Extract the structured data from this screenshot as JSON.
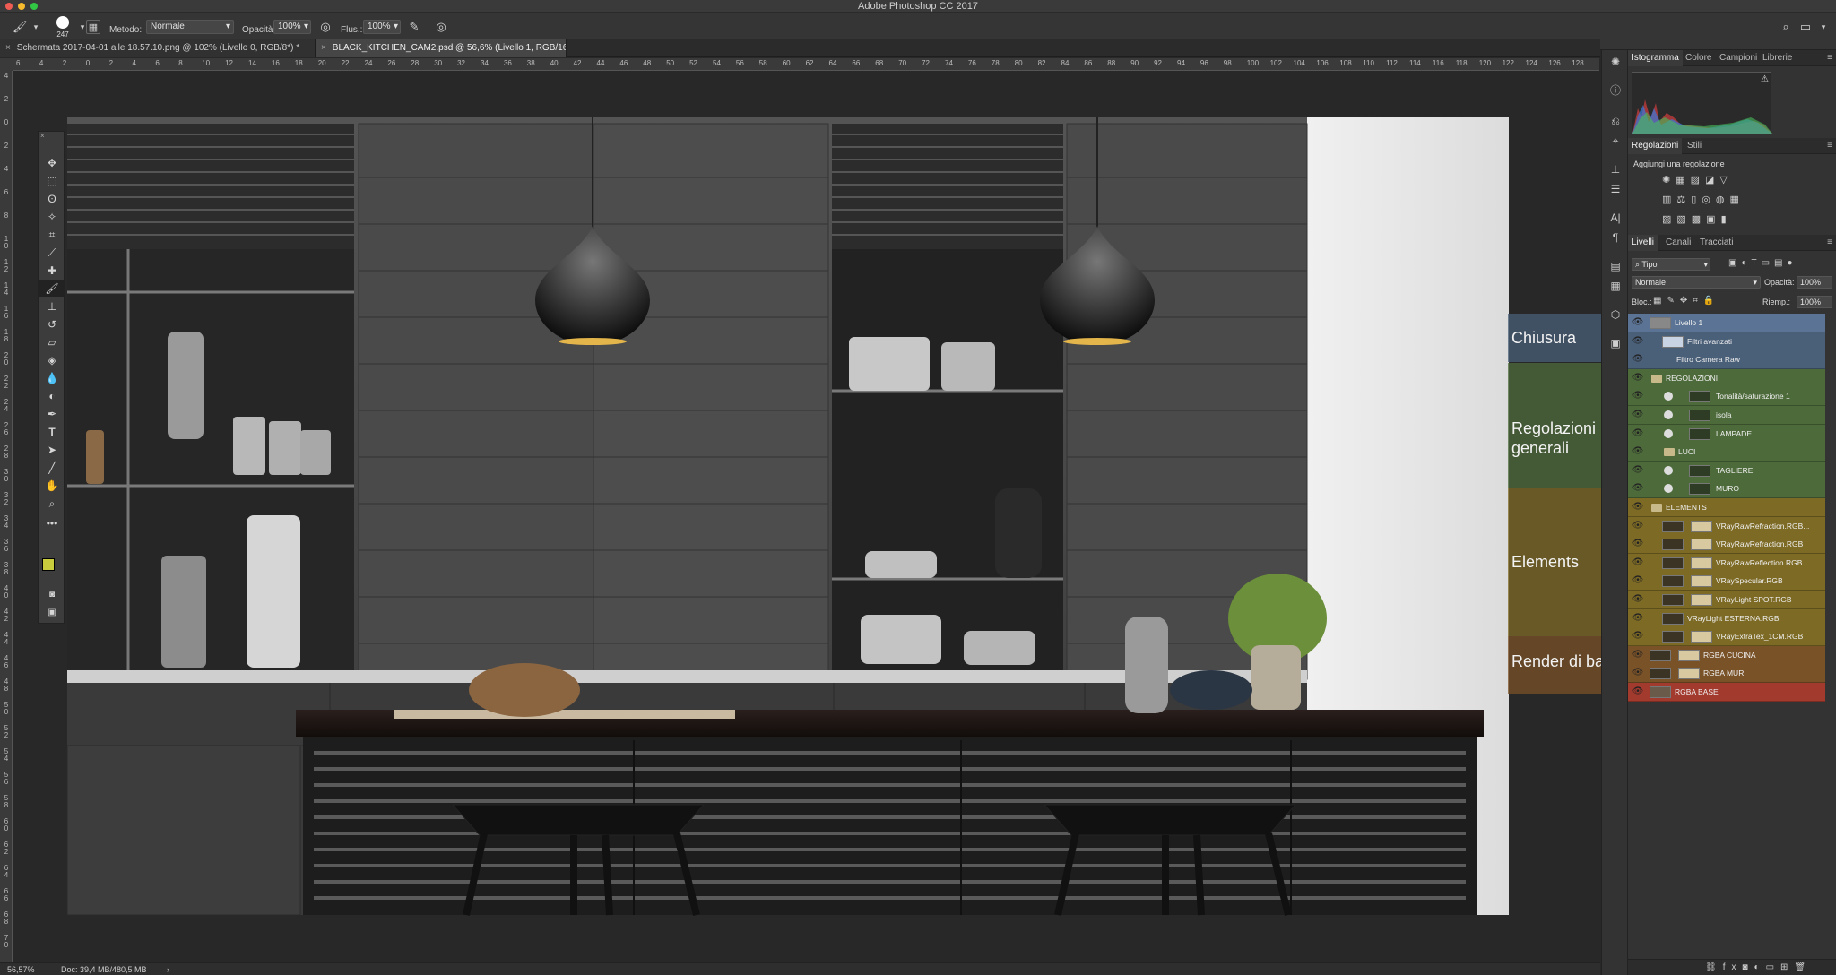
{
  "app": {
    "title": "Adobe Photoshop CC 2017"
  },
  "options": {
    "brush_size": "247",
    "mode_label": "Metodo:",
    "mode_value": "Normale",
    "opacity_label": "Opacità:",
    "opacity_value": "100%",
    "flow_label": "Flus.:",
    "flow_value": "100%"
  },
  "tabs": [
    {
      "label": "Schermata 2017-04-01 alle 18.57.10.png @ 102% (Livello 0, RGB/8*) *",
      "active": false
    },
    {
      "label": "BLACK_KITCHEN_CAM2.psd @ 56,6% (Livello 1, RGB/16) *",
      "active": true
    }
  ],
  "ruler": {
    "h": [
      "6",
      "4",
      "2",
      "0",
      "2",
      "4",
      "6",
      "8",
      "10",
      "12",
      "14",
      "16",
      "18",
      "20",
      "22",
      "24",
      "26",
      "28",
      "30",
      "32",
      "34",
      "36",
      "38",
      "40",
      "42",
      "44",
      "46",
      "48",
      "50",
      "52",
      "54",
      "56",
      "58",
      "60",
      "62",
      "64",
      "66",
      "68",
      "70",
      "72",
      "74",
      "76",
      "78",
      "80",
      "82",
      "84",
      "86",
      "88",
      "90",
      "92",
      "94",
      "96",
      "98",
      "100",
      "102",
      "104",
      "106",
      "108",
      "110",
      "112",
      "114",
      "116",
      "118",
      "120",
      "122",
      "124",
      "126",
      "128"
    ],
    "v": [
      "4",
      "2",
      "0",
      "2",
      "4",
      "6",
      "8",
      "1\n0",
      "1\n2",
      "1\n4",
      "1\n6",
      "1\n8",
      "2\n0",
      "2\n2",
      "2\n4",
      "2\n6",
      "2\n8",
      "3\n0",
      "3\n2",
      "3\n4",
      "3\n6",
      "3\n8",
      "4\n0",
      "4\n2",
      "4\n4",
      "4\n6",
      "4\n8",
      "5\n0",
      "5\n2",
      "5\n4",
      "5\n6",
      "5\n8",
      "6\n0",
      "6\n2",
      "6\n4",
      "6\n6",
      "6\n8",
      "7\n0"
    ]
  },
  "status": {
    "zoom": "56,57%",
    "doc": "Doc: 39,4 MB/480,5 MB"
  },
  "panels": {
    "top_tabs": [
      "Istogramma",
      "Colore",
      "Campioni",
      "Librerie"
    ],
    "adj_tabs": [
      "Regolazioni",
      "Stili"
    ],
    "adj_title": "Aggiungi una regolazione",
    "layers_tabs": [
      "Livelli",
      "Canali",
      "Tracciati"
    ],
    "filter_kind": "Tipo",
    "blend_mode": "Normale",
    "opacity_label": "Opacità:",
    "opacity_value": "100%",
    "lock_label": "Bloc.:",
    "fill_label": "Riemp.:",
    "fill_value": "100%"
  },
  "layers": [
    {
      "name": "Livello 1",
      "group": "blue",
      "indent": 0,
      "kind": "smart"
    },
    {
      "name": "Filtri avanzati",
      "group": "blue",
      "indent": 1,
      "kind": "filter"
    },
    {
      "name": "Filtro Camera Raw",
      "group": "blue",
      "indent": 2,
      "kind": "filter-item"
    },
    {
      "name": "REGOLAZIONI",
      "group": "green",
      "indent": 0,
      "kind": "folder"
    },
    {
      "name": "Tonalità/saturazione 1",
      "group": "green",
      "indent": 1,
      "kind": "adj"
    },
    {
      "name": "isola",
      "group": "green",
      "indent": 1,
      "kind": "adj"
    },
    {
      "name": "LAMPADE",
      "group": "green",
      "indent": 1,
      "kind": "adj"
    },
    {
      "name": "LUCI",
      "group": "green",
      "indent": 1,
      "kind": "folder"
    },
    {
      "name": "TAGLIERE",
      "group": "green",
      "indent": 1,
      "kind": "adj"
    },
    {
      "name": "MURO",
      "group": "green",
      "indent": 1,
      "kind": "adj"
    },
    {
      "name": "ELEMENTS",
      "group": "yellow",
      "indent": 0,
      "kind": "folder"
    },
    {
      "name": "VRayRawRefraction.RGB...",
      "group": "yellow",
      "indent": 1,
      "kind": "img"
    },
    {
      "name": "VRayRawRefraction.RGB",
      "group": "yellow",
      "indent": 1,
      "kind": "img"
    },
    {
      "name": "VRayRawReflection.RGB...",
      "group": "yellow",
      "indent": 1,
      "kind": "img"
    },
    {
      "name": "VRaySpecular.RGB",
      "group": "yellow",
      "indent": 1,
      "kind": "img"
    },
    {
      "name": "VRayLight SPOT.RGB",
      "group": "yellow",
      "indent": 1,
      "kind": "img"
    },
    {
      "name": "VRayLight ESTERNA.RGB",
      "group": "yellow",
      "indent": 1,
      "kind": "img1"
    },
    {
      "name": "VRayExtraTex_1CM.RGB",
      "group": "yellow",
      "indent": 1,
      "kind": "img"
    },
    {
      "name": "RGBA CUCINA",
      "group": "orange",
      "indent": 0,
      "kind": "img"
    },
    {
      "name": "RGBA MURI",
      "group": "orange",
      "indent": 0,
      "kind": "img"
    },
    {
      "name": "RGBA BASE",
      "group": "red",
      "indent": 0,
      "kind": "base"
    }
  ],
  "annotations": [
    {
      "text": "Chiusura",
      "group": "blue"
    },
    {
      "text": "Regolazioni generali",
      "group": "green"
    },
    {
      "text": "Elements",
      "group": "yellow"
    },
    {
      "text": "Render di base",
      "group": "orange"
    }
  ],
  "colors": {
    "blue": "#4a5f78",
    "green": "#4d6a3a",
    "yellow": "#7d6a25",
    "orange": "#7a5228",
    "red": "#a33a2e",
    "foreground_swatch": "#c9cc3c"
  }
}
